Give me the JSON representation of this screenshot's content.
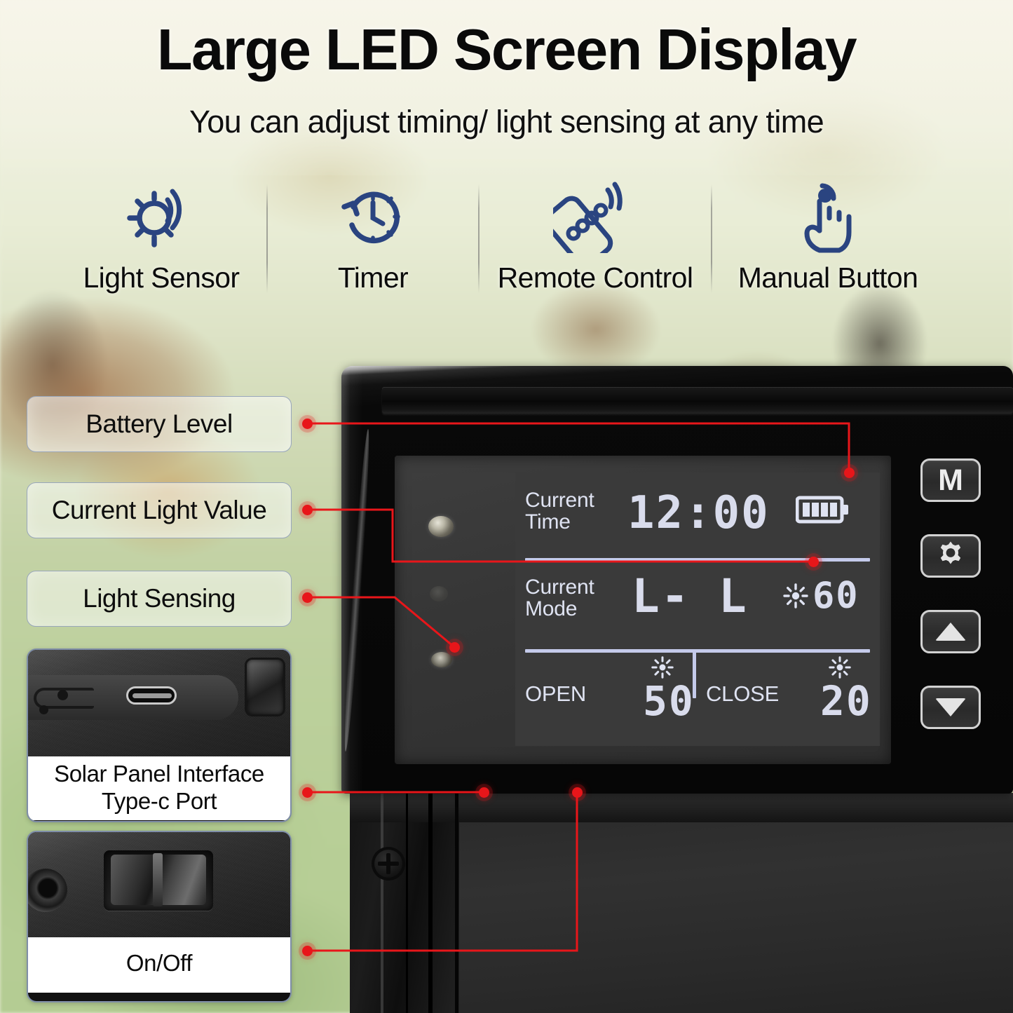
{
  "header": {
    "title": "Large LED Screen Display",
    "subtitle": "You can adjust timing/ light sensing at any time"
  },
  "features": [
    {
      "label": "Light Sensor",
      "icon": "light-sensor-icon"
    },
    {
      "label": "Timer",
      "icon": "timer-clock-icon"
    },
    {
      "label": "Remote Control",
      "icon": "remote-control-icon"
    },
    {
      "label": "Manual Button",
      "icon": "hand-press-icon"
    }
  ],
  "callouts": [
    {
      "label": "Battery Level"
    },
    {
      "label": "Current Light Value"
    },
    {
      "label": "Light Sensing"
    }
  ],
  "insets": [
    {
      "caption_line1": "Solar Panel Interface",
      "caption_line2": "Type-c Port"
    },
    {
      "caption_line1": "On/Off",
      "caption_line2": ""
    }
  ],
  "lcd": {
    "current_time_label_line1": "Current",
    "current_time_label_line2": "Time",
    "time_value": "12:00",
    "battery_icon": "battery-full-icon",
    "battery_bars": 4,
    "current_mode_label_line1": "Current",
    "current_mode_label_line2": "Mode",
    "mode_value_left": "L-",
    "mode_value_right": "L",
    "mode_light_icon": "sun-icon",
    "mode_light_value": "60",
    "open_label": "OPEN",
    "open_icon": "sun-icon",
    "open_value": "50",
    "close_label": "CLOSE",
    "close_icon": "sun-icon",
    "close_value": "20"
  },
  "buttons": [
    {
      "label": "M",
      "icon": "letter-m-icon"
    },
    {
      "label": "",
      "icon": "gear-icon"
    },
    {
      "label": "",
      "icon": "arrow-up-icon"
    },
    {
      "label": "",
      "icon": "arrow-down-icon"
    }
  ],
  "colors": {
    "accent_blue": "#2a4480",
    "callout_red": "#e8161a",
    "lcd_text": "#dfe3f2",
    "lcd_background": "#3a3a3a"
  }
}
